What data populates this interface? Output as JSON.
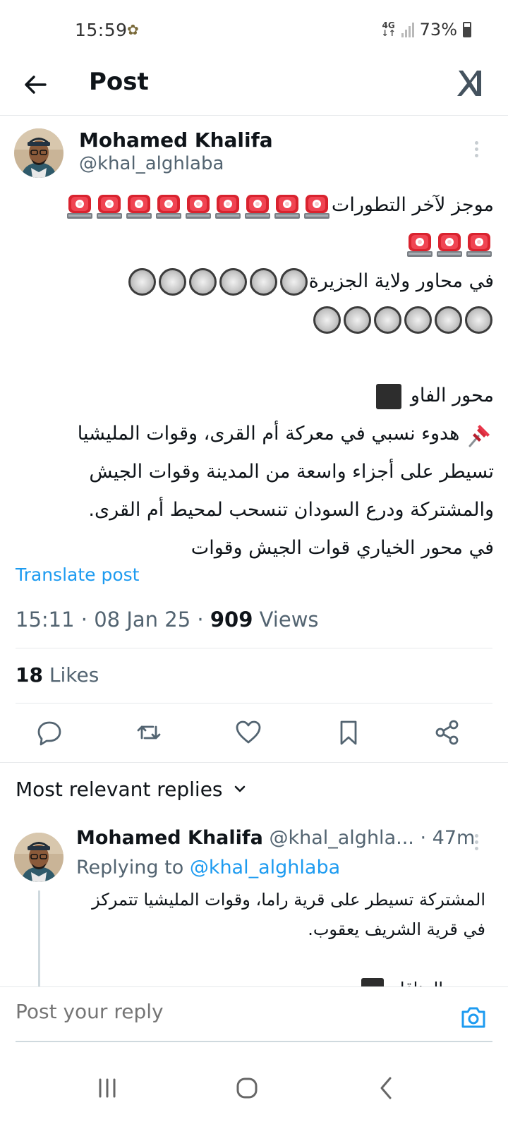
{
  "status_bar": {
    "time": "15:59",
    "network": "4G",
    "battery": "73%"
  },
  "header": {
    "title": "Post",
    "brand_icon": "xl-logo-icon"
  },
  "post": {
    "author_name": "Mohamed Khalifa",
    "author_handle": "@khal_alghlaba",
    "lines": [
      "موجز لآخر التطورات",
      "في محاور ولاية الجزيرة",
      "محور الفاو",
      "هدوء نسبي في معركة أم القرى، وقوات المليشيا",
      "تسيطر على أجزاء واسعة من المدينة وقوات الجيش",
      "والمشتركة ودرع السودان تنسحب لمحيط أم القرى.",
      "في محور الخياري قوات الجيش وقوات"
    ],
    "translate_label": "Translate post",
    "time": "15:11",
    "date": "08 Jan 25",
    "views_count": "909",
    "views_label": "Views",
    "likes_count": "18",
    "likes_label": "Likes",
    "meta_separator": "·"
  },
  "actions": [
    "reply-icon",
    "repost-icon",
    "like-icon",
    "bookmark-icon",
    "share-icon"
  ],
  "replies": {
    "sort_label": "Most relevant replies",
    "items": [
      {
        "author_name": "Mohamed Khalifa",
        "author_handle": "@khal_alghla...",
        "age": "47m",
        "replying_prefix": "Replying to",
        "replying_handle": "@khal_alghlaba",
        "lines": [
          "المشتركة تسيطر على قرية راما، وقوات المليشيا تتمركز",
          "في قرية الشريف يعقوب.",
          "محور المناقل"
        ]
      }
    ]
  },
  "reply_bar": {
    "placeholder": "Post your reply"
  },
  "colors": {
    "accent": "#1d9bf0",
    "text_primary": "#0f1419",
    "text_secondary": "#536471",
    "divider": "#e6e9eb"
  }
}
